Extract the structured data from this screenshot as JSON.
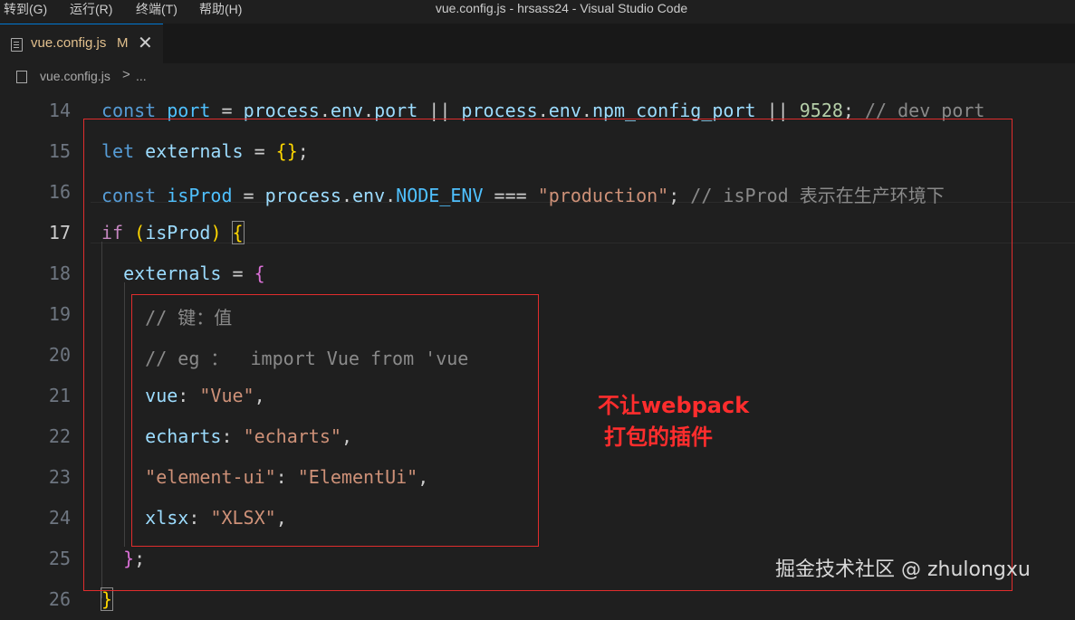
{
  "menu": [
    "转到(G)",
    "运行(R)",
    "终端(T)",
    "帮助(H)"
  ],
  "window_title": "vue.config.js - hrsass24 - Visual Studio Code",
  "tab": {
    "file_name": "vue.config.js",
    "modified_flag": "M",
    "close_symbol": "✕"
  },
  "breadcrumb": {
    "file": "vue.config.js",
    "separator": ">",
    "more": "..."
  },
  "editor": {
    "current_line": 17,
    "lines": [
      {
        "n": "14",
        "tokens": [
          {
            "t": "const",
            "c": "kw"
          },
          {
            "t": " "
          },
          {
            "t": "port",
            "c": "cst"
          },
          {
            "t": " = "
          },
          {
            "t": "process",
            "c": "vr"
          },
          {
            "t": "."
          },
          {
            "t": "env",
            "c": "vr"
          },
          {
            "t": "."
          },
          {
            "t": "port",
            "c": "vr"
          },
          {
            "t": " || "
          },
          {
            "t": "process",
            "c": "vr"
          },
          {
            "t": "."
          },
          {
            "t": "env",
            "c": "vr"
          },
          {
            "t": "."
          },
          {
            "t": "npm_config_port",
            "c": "vr"
          },
          {
            "t": " || "
          },
          {
            "t": "9528",
            "c": "num"
          },
          {
            "t": "; "
          },
          {
            "t": "// dev port",
            "c": "com2"
          }
        ]
      },
      {
        "n": "15",
        "tokens": [
          {
            "t": "let",
            "c": "kw"
          },
          {
            "t": " "
          },
          {
            "t": "externals",
            "c": "vr"
          },
          {
            "t": " = "
          },
          {
            "t": "{}",
            "c": "b1"
          },
          {
            "t": ";"
          }
        ]
      },
      {
        "n": "16",
        "tokens": [
          {
            "t": "const",
            "c": "kw"
          },
          {
            "t": " "
          },
          {
            "t": "isProd",
            "c": "cst"
          },
          {
            "t": " = "
          },
          {
            "t": "process",
            "c": "vr"
          },
          {
            "t": "."
          },
          {
            "t": "env",
            "c": "vr"
          },
          {
            "t": "."
          },
          {
            "t": "NODE_ENV",
            "c": "cst"
          },
          {
            "t": " === "
          },
          {
            "t": "\"production\"",
            "c": "str"
          },
          {
            "t": "; "
          },
          {
            "t": "// isProd 表示在生产环境下",
            "c": "com2"
          }
        ]
      },
      {
        "n": "17",
        "tokens": [
          {
            "t": "if",
            "c": "ctl"
          },
          {
            "t": " "
          },
          {
            "t": "(",
            "c": "b1"
          },
          {
            "t": "isProd",
            "c": "vr"
          },
          {
            "t": ")",
            "c": "b1"
          },
          {
            "t": " "
          },
          {
            "t": "{",
            "c": "b1 bm"
          }
        ]
      },
      {
        "n": "18",
        "tokens": [
          {
            "t": "  "
          },
          {
            "t": "externals",
            "c": "vr"
          },
          {
            "t": " = "
          },
          {
            "t": "{",
            "c": "b2"
          }
        ]
      },
      {
        "n": "19",
        "tokens": [
          {
            "t": "    "
          },
          {
            "t": "// 键：值",
            "c": "com2"
          }
        ]
      },
      {
        "n": "20",
        "tokens": [
          {
            "t": "    "
          },
          {
            "t": "// eg ：  import Vue from 'vue",
            "c": "com2"
          }
        ]
      },
      {
        "n": "21",
        "tokens": [
          {
            "t": "    "
          },
          {
            "t": "vue",
            "c": "vr"
          },
          {
            "t": ": "
          },
          {
            "t": "\"Vue\"",
            "c": "str"
          },
          {
            "t": ","
          }
        ]
      },
      {
        "n": "22",
        "tokens": [
          {
            "t": "    "
          },
          {
            "t": "echarts",
            "c": "vr"
          },
          {
            "t": ": "
          },
          {
            "t": "\"echarts\"",
            "c": "str"
          },
          {
            "t": ","
          }
        ]
      },
      {
        "n": "23",
        "tokens": [
          {
            "t": "    "
          },
          {
            "t": "\"element-ui\"",
            "c": "str"
          },
          {
            "t": ": "
          },
          {
            "t": "\"ElementUi\"",
            "c": "str"
          },
          {
            "t": ","
          }
        ]
      },
      {
        "n": "24",
        "tokens": [
          {
            "t": "    "
          },
          {
            "t": "xlsx",
            "c": "vr"
          },
          {
            "t": ": "
          },
          {
            "t": "\"XLSX\"",
            "c": "str"
          },
          {
            "t": ","
          }
        ]
      },
      {
        "n": "25",
        "tokens": [
          {
            "t": "  "
          },
          {
            "t": "}",
            "c": "b2"
          },
          {
            "t": ";"
          }
        ]
      },
      {
        "n": "26",
        "tokens": [
          {
            "t": "}",
            "c": "b1 bm"
          }
        ]
      }
    ]
  },
  "annotation": {
    "line1": "不让webpack",
    "line2": "打包的插件",
    "color": "#ff2d2d"
  },
  "watermark": "掘金技术社区 @ zhulongxu",
  "colors": {
    "background": "#1f1f1f",
    "highlight_box": "#e02d2d",
    "tab_modified": "#e2c08d"
  }
}
